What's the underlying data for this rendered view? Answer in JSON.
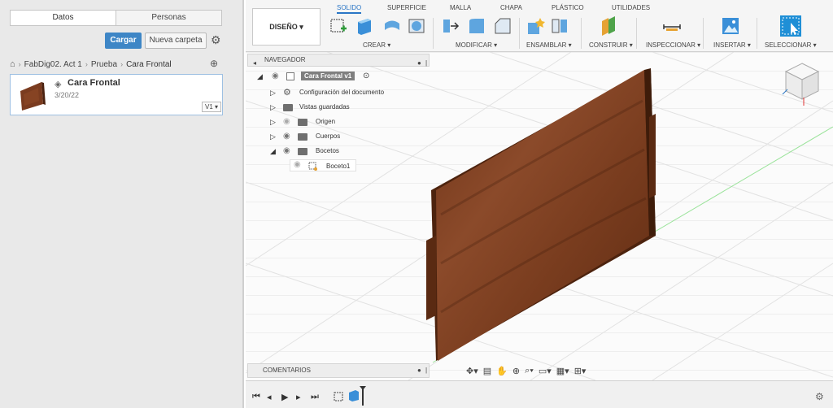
{
  "data_panel": {
    "tabs": [
      "Datos",
      "Personas"
    ],
    "upload_label": "Cargar",
    "new_folder_label": "Nueva carpeta",
    "breadcrumb": [
      "FabDig02. Act 1",
      "Prueba",
      "Cara Frontal"
    ],
    "file": {
      "name": "Cara Frontal",
      "date": "3/20/22",
      "version": "V1 ▾"
    }
  },
  "toolbar": {
    "workspace_label": "DISEÑO ▾",
    "tabs": [
      "SOLIDO",
      "SUPERFICIE",
      "MALLA",
      "CHAPA",
      "PLÁSTICO",
      "UTILIDADES"
    ],
    "groups": [
      "CREAR ▾",
      "MODIFICAR ▾",
      "ENSAMBLAR ▾",
      "CONSTRUIR ▾",
      "INSPECCIONAR ▾",
      "INSERTAR ▾",
      "SELECCIONAR ▾"
    ]
  },
  "browser": {
    "title": "NAVEGADOR",
    "root": "Cara Frontal v1",
    "items": [
      "Configuración del documento",
      "Vistas guardadas",
      "Origen",
      "Cuerpos",
      "Bocetos",
      "Boceto1"
    ]
  },
  "comments_label": "COMENTARIOS",
  "colors": {
    "accent": "#2a76c6",
    "primary_button": "#3e86c6",
    "wood": "#7a3b1f"
  }
}
